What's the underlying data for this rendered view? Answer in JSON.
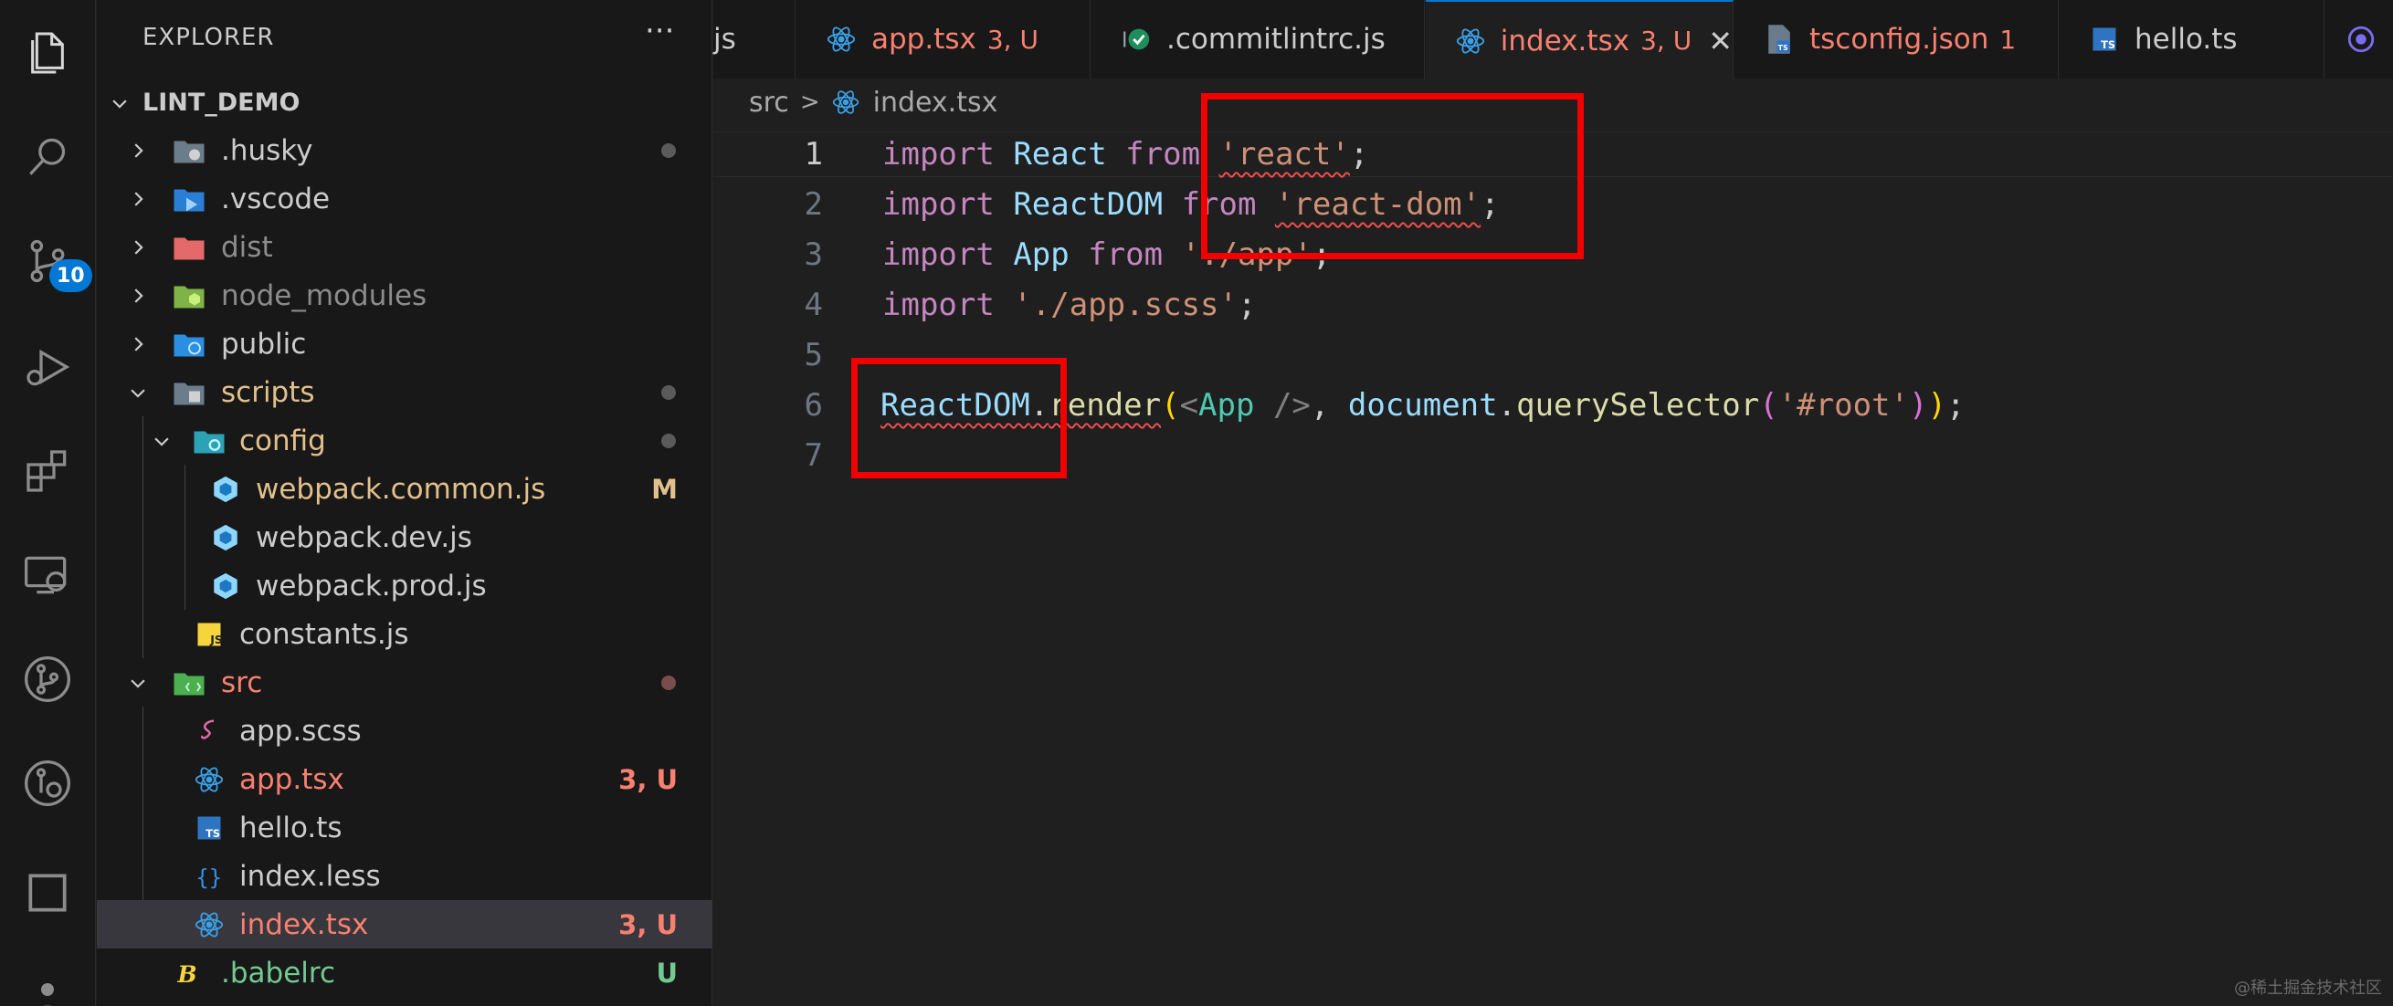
{
  "activity_bar": {
    "source_control_badge": "10",
    "items": [
      "explorer-icon",
      "search-icon",
      "source-control-icon",
      "run-debug-icon",
      "extensions-icon",
      "remote-explorer-icon",
      "git-graph-icon",
      "gitlens-icon",
      "square-icon",
      "accounts-icon"
    ]
  },
  "explorer": {
    "title": "EXPLORER",
    "more": "···",
    "root": "LINT_DEMO",
    "items": [
      {
        "name": ".husky",
        "kind": "folder"
      },
      {
        "name": ".vscode",
        "kind": "folder"
      },
      {
        "name": "dist",
        "kind": "folder"
      },
      {
        "name": "node_modules",
        "kind": "folder"
      },
      {
        "name": "public",
        "kind": "folder"
      },
      {
        "name": "scripts",
        "kind": "folder"
      },
      {
        "name": "config",
        "kind": "folder"
      },
      {
        "name": "webpack.common.js",
        "decoration": "M"
      },
      {
        "name": "webpack.dev.js"
      },
      {
        "name": "webpack.prod.js"
      },
      {
        "name": "constants.js"
      },
      {
        "name": "src",
        "kind": "folder"
      },
      {
        "name": "app.scss"
      },
      {
        "name": "app.tsx",
        "decoration": "3, U"
      },
      {
        "name": "hello.ts"
      },
      {
        "name": "index.less"
      },
      {
        "name": "index.tsx",
        "decoration": "3, U"
      },
      {
        "name": ".babelrc",
        "decoration": "U"
      }
    ]
  },
  "tabs": [
    {
      "name": "js",
      "decoration": ""
    },
    {
      "name": "app.tsx",
      "decoration": "3, U"
    },
    {
      "name": ".commitlintrc.js",
      "decoration": ""
    },
    {
      "name": "index.tsx",
      "decoration": "3, U",
      "close": "✕"
    },
    {
      "name": "tsconfig.json",
      "decoration": "1"
    },
    {
      "name": "hello.ts",
      "decoration": ""
    }
  ],
  "breadcrumb": {
    "folder": "src",
    "separator": ">",
    "file": "index.tsx"
  },
  "editor": {
    "line_numbers": [
      "1",
      "2",
      "3",
      "4",
      "5",
      "6",
      "7"
    ],
    "tokens": {
      "import": "import",
      "from": "from",
      "React": "React",
      "ReactDOM": "ReactDOM",
      "App": "App",
      "react_str": "'react'",
      "react_dom_str": "'react-dom'",
      "app_str": "'./app'",
      "scss_str": "'./app.scss'",
      "semi": ";",
      "dot": ".",
      "render": "render",
      "open_paren": "(",
      "close_paren": ")",
      "lt": "<",
      "self_close": " />",
      "comma": ", ",
      "document": "document",
      "querySelector": "querySelector",
      "root_str": "'#root'"
    }
  },
  "watermark": "@稀土掘金技术社区",
  "colors": {
    "highlight_box": "#f20000",
    "accent": "#0078d4"
  }
}
